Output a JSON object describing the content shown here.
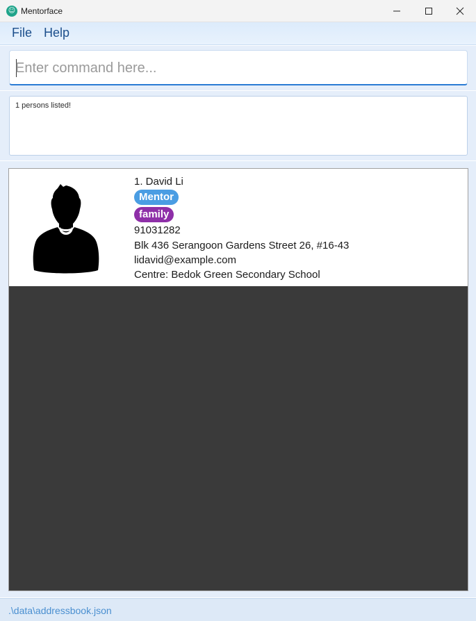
{
  "window": {
    "title": "Mentorface",
    "icon": "mentorface-app-icon"
  },
  "menu": {
    "items": [
      "File",
      "Help"
    ]
  },
  "command": {
    "placeholder": "Enter command here...",
    "value": ""
  },
  "result": {
    "message": "1 persons listed!"
  },
  "persons": [
    {
      "index_name": "1. David Li",
      "tags": [
        "Mentor",
        "family"
      ],
      "phone": "91031282",
      "address": "Blk 436 Serangoon Gardens Street 26, #16-43",
      "email": "lidavid@example.com",
      "centre": "Centre: Bedok Green Secondary School",
      "avatar": "person-silhouette-icon"
    }
  ],
  "status": {
    "file_path": ".\\data\\addressbook.json"
  },
  "colors": {
    "tag_mentor": "#4a9de3",
    "tag_family": "#8e2fa8",
    "list_background": "#3a3a3a",
    "accent": "#2a7bd4"
  }
}
